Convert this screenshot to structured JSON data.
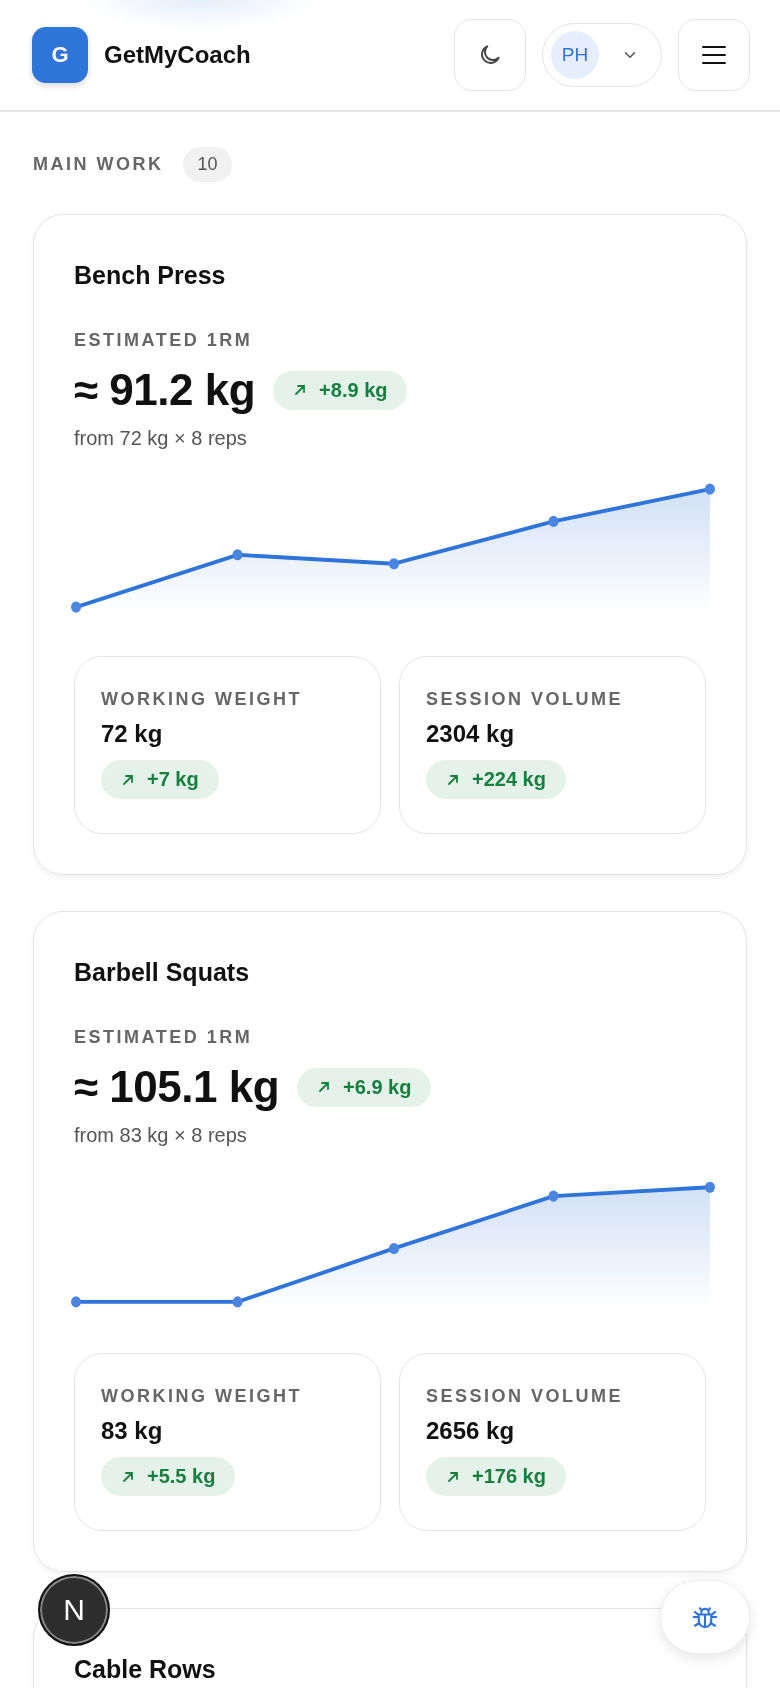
{
  "header": {
    "logo_letter": "G",
    "app_name": "GetMyCoach",
    "avatar_initials": "PH"
  },
  "section": {
    "title": "MAIN WORK",
    "count": "10"
  },
  "exercises": [
    {
      "name": "Bench Press",
      "estimate_label": "ESTIMATED 1RM",
      "estimate": "≈ 91.2 kg",
      "estimate_change": "+8.9 kg",
      "basis": "from 72 kg × 8 reps",
      "stats": [
        {
          "label": "WORKING WEIGHT",
          "value": "72 kg",
          "change": "+7 kg"
        },
        {
          "label": "SESSION VOLUME",
          "value": "2304 kg",
          "change": "+224 kg"
        }
      ]
    },
    {
      "name": "Barbell Squats",
      "estimate_label": "ESTIMATED 1RM",
      "estimate": "≈ 105.1 kg",
      "estimate_change": "+6.9 kg",
      "basis": "from 83 kg × 8 reps",
      "stats": [
        {
          "label": "WORKING WEIGHT",
          "value": "83 kg",
          "change": "+5.5 kg"
        },
        {
          "label": "SESSION VOLUME",
          "value": "2656 kg",
          "change": "+176 kg"
        }
      ]
    },
    {
      "name": "Cable Rows"
    }
  ],
  "dev_badge": {
    "letter": "N"
  }
}
